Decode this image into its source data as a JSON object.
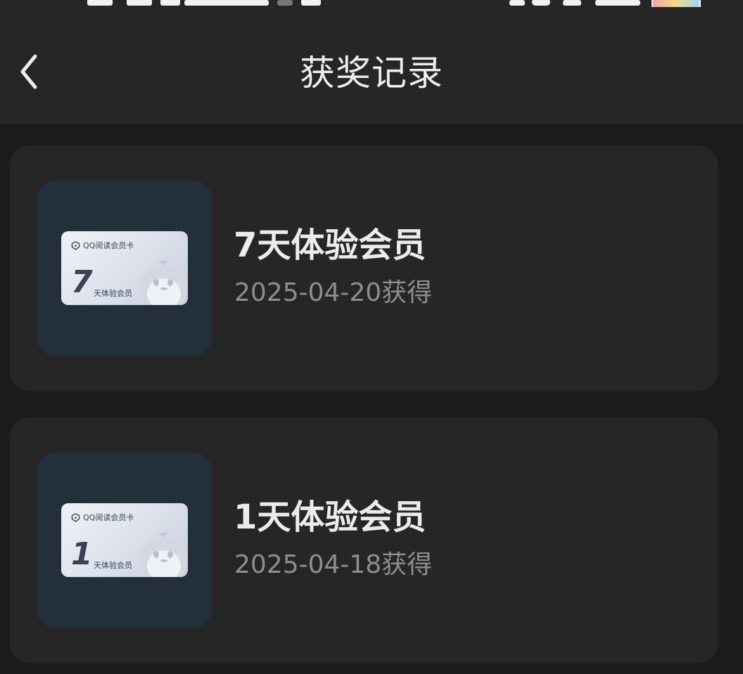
{
  "header": {
    "title": "获奖记录",
    "back_icon": "chevron-left-icon"
  },
  "records": [
    {
      "title": "7天体验会员",
      "date": "2025-04-20获得",
      "card": {
        "brand": "QQ阅读会员卡",
        "number": "7",
        "subtitle": "天体验会员"
      }
    },
    {
      "title": "1天体验会员",
      "date": "2025-04-18获得",
      "card": {
        "brand": "QQ阅读会员卡",
        "number": "1",
        "subtitle": "天体验会员"
      }
    }
  ],
  "colors": {
    "background": "#1b1b1b",
    "surface": "#262626",
    "thumb_bg": "#233039",
    "title_text": "#ececec",
    "date_text": "#8e8e8e"
  }
}
